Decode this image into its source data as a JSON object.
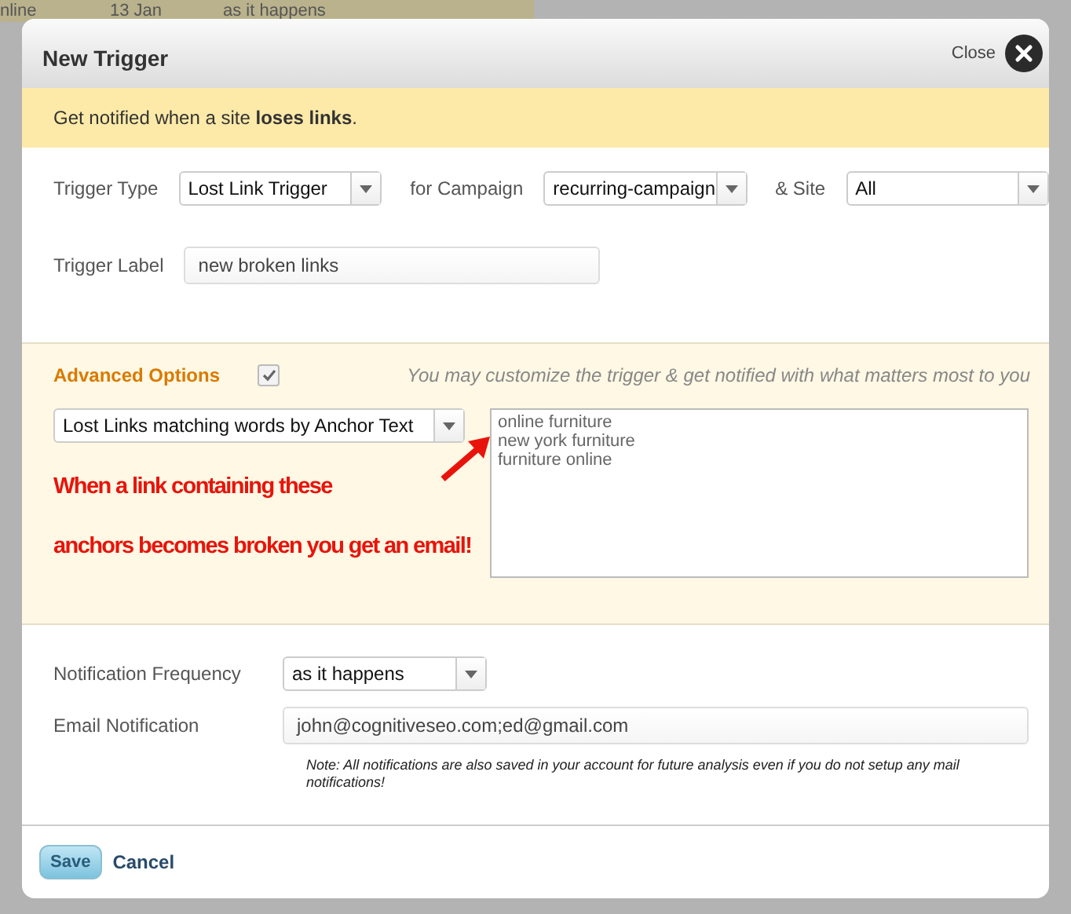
{
  "background_row": [
    "nline",
    "13 Jan",
    "as it happens"
  ],
  "dialog": {
    "title": "New Trigger",
    "close_label": "Close"
  },
  "banner": "Get notified when a site **loses links**.",
  "trigger_type": {
    "label": "Trigger Type",
    "value": "Lost Link Trigger"
  },
  "campaign": {
    "label": "for Campaign",
    "value": "recurring-campaign"
  },
  "site": {
    "label": "& Site",
    "value": "All"
  },
  "trigger_label": {
    "label": "Trigger Label",
    "value": "new broken links"
  },
  "advanced": {
    "title": "Advanced Options",
    "checked": true,
    "hint": "You may customize the trigger & get notified with what matters most to you",
    "filter": "Lost Links matching words by Anchor Text",
    "keywords": [
      "online furniture",
      "new york furniture",
      "furniture online"
    ],
    "annotation": [
      "When a link containing these",
      "anchors becomes broken you get an email!"
    ]
  },
  "frequency": {
    "label": "Notification Frequency",
    "value": "as it happens"
  },
  "email": {
    "label": "Email Notification",
    "value": "john@cognitiveseo.com;ed@gmail.com",
    "note": "Note: All notifications are also saved in your account for future analysis even if you do not setup any mail notifications!"
  },
  "buttons": {
    "save": "Save",
    "cancel": "Cancel"
  }
}
